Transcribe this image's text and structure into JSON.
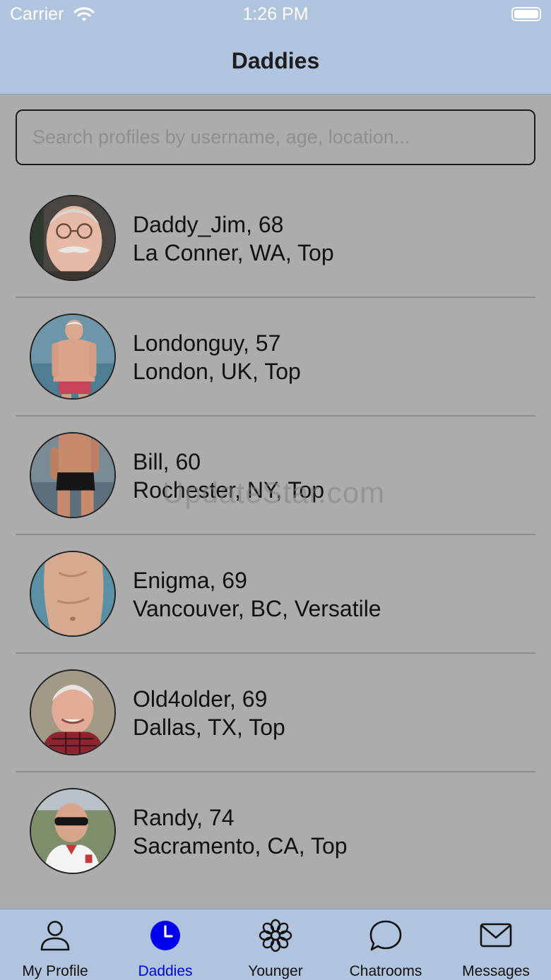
{
  "status_bar": {
    "carrier": "Carrier",
    "time": "1:26 PM"
  },
  "header": {
    "title": "Daddies"
  },
  "search": {
    "placeholder": "Search profiles by username, age, location..."
  },
  "profiles": [
    {
      "name_age": "Daddy_Jim, 68",
      "location_role": "La Conner, WA, Top",
      "avatar": "portrait-glasses-mustache"
    },
    {
      "name_age": "Londonguy, 57",
      "location_role": "London, UK, Top",
      "avatar": "beach-swimwear"
    },
    {
      "name_age": "Bill, 60",
      "location_role": "Rochester, NY, Top",
      "avatar": "poolside-swimwear"
    },
    {
      "name_age": "Enigma, 69",
      "location_role": "Vancouver, BC, Versatile",
      "avatar": "torso-closeup"
    },
    {
      "name_age": "Old4older, 69",
      "location_role": "Dallas, TX, Top",
      "avatar": "portrait-plaid-shirt"
    },
    {
      "name_age": "Randy, 74",
      "location_role": "Sacramento, CA, Top",
      "avatar": "portrait-sunglasses"
    }
  ],
  "watermark": "UpdateStar.com",
  "tabs": [
    {
      "label": "My Profile",
      "icon": "person-icon",
      "active": false
    },
    {
      "label": "Daddies",
      "icon": "clock-icon",
      "active": true
    },
    {
      "label": "Younger",
      "icon": "flower-icon",
      "active": false
    },
    {
      "label": "Chatrooms",
      "icon": "chat-bubble-icon",
      "active": false
    },
    {
      "label": "Messages",
      "icon": "envelope-icon",
      "active": false
    }
  ],
  "colors": {
    "header_bg": "#b0c4de",
    "content_bg": "#acacac",
    "active_tab": "#0000ee"
  }
}
